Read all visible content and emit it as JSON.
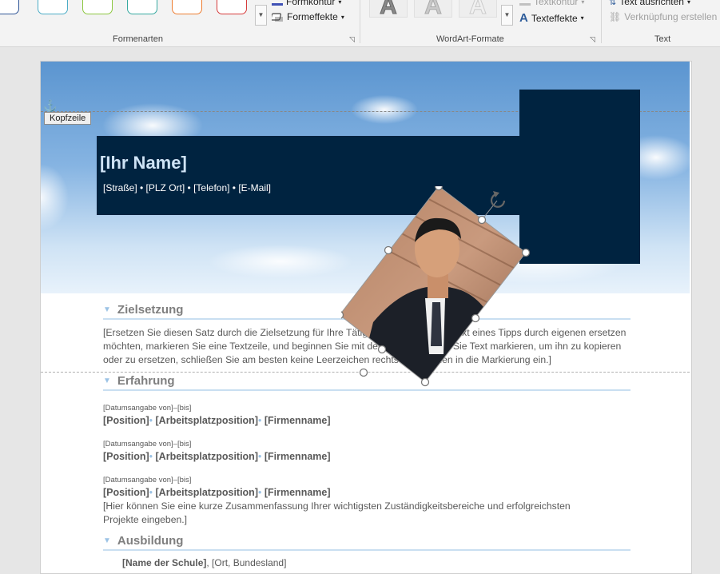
{
  "ribbon": {
    "groups": {
      "formenarten": "Formenarten",
      "wordart": "WordArt-Formate",
      "text": "Text"
    },
    "shape_styles": {
      "formkontur_label": "Formkontur",
      "formeffekte_label": "Formeffekte",
      "outline_colors": [
        "#2f5597",
        "#4bacc6",
        "#8cc63f",
        "#36a9a0",
        "#ed7d31",
        "#d63b3b"
      ]
    },
    "wordart": {
      "textkontur_label": "Textkontur",
      "texteffekte_label": "Texteffekte"
    },
    "text_group": {
      "align_label": "Text ausrichten",
      "link_label": "Verknüpfung erstellen"
    }
  },
  "document": {
    "header_tag": "Kopfzeile",
    "name": "[Ihr Name]",
    "contact": "[Straße] • [PLZ Ort] • [Telefon] • [E-Mail]",
    "sections": {
      "zielsetzung": {
        "title": "Zielsetzung",
        "text": "[Ersetzen Sie diesen Satz durch die Zielsetzung für Ihre Tätigkeit. Wenn Sie den Text eines Tipps durch eigenen ersetzen möchten, markieren Sie eine Textzeile, und beginnen Sie mit der Eingabe. Wenn Sie Text markieren, um ihn zu kopieren oder zu ersetzen, schließen Sie am besten keine Leerzeichen rechts der Zeichen in die Markierung ein.]"
      },
      "erfahrung": {
        "title": "Erfahrung",
        "entries": [
          {
            "date": "[Datumsangabe von]–[bis]",
            "position": "[Position]",
            "workplace": "[Arbeitsplatzposition]",
            "company": "[Firmenname]"
          },
          {
            "date": "[Datumsangabe von]–[bis]",
            "position": "[Position]",
            "workplace": "[Arbeitsplatzposition]",
            "company": "[Firmenname]"
          },
          {
            "date": "[Datumsangabe von]–[bis]",
            "position": "[Position]",
            "workplace": "[Arbeitsplatzposition]",
            "company": "[Firmenname]",
            "summary": "[Hier können Sie eine kurze Zusammenfassung Ihrer wichtigsten Zuständigkeitsbereiche und erfolgreichsten Projekte eingeben.]"
          }
        ]
      },
      "ausbildung": {
        "title": "Ausbildung",
        "school": "[Name der Schule]",
        "location": "[Ort, Bundesland]"
      }
    }
  },
  "colors": {
    "navy": "#002340",
    "accent_light_blue": "#9cc3e5",
    "body_text": "#595959"
  }
}
